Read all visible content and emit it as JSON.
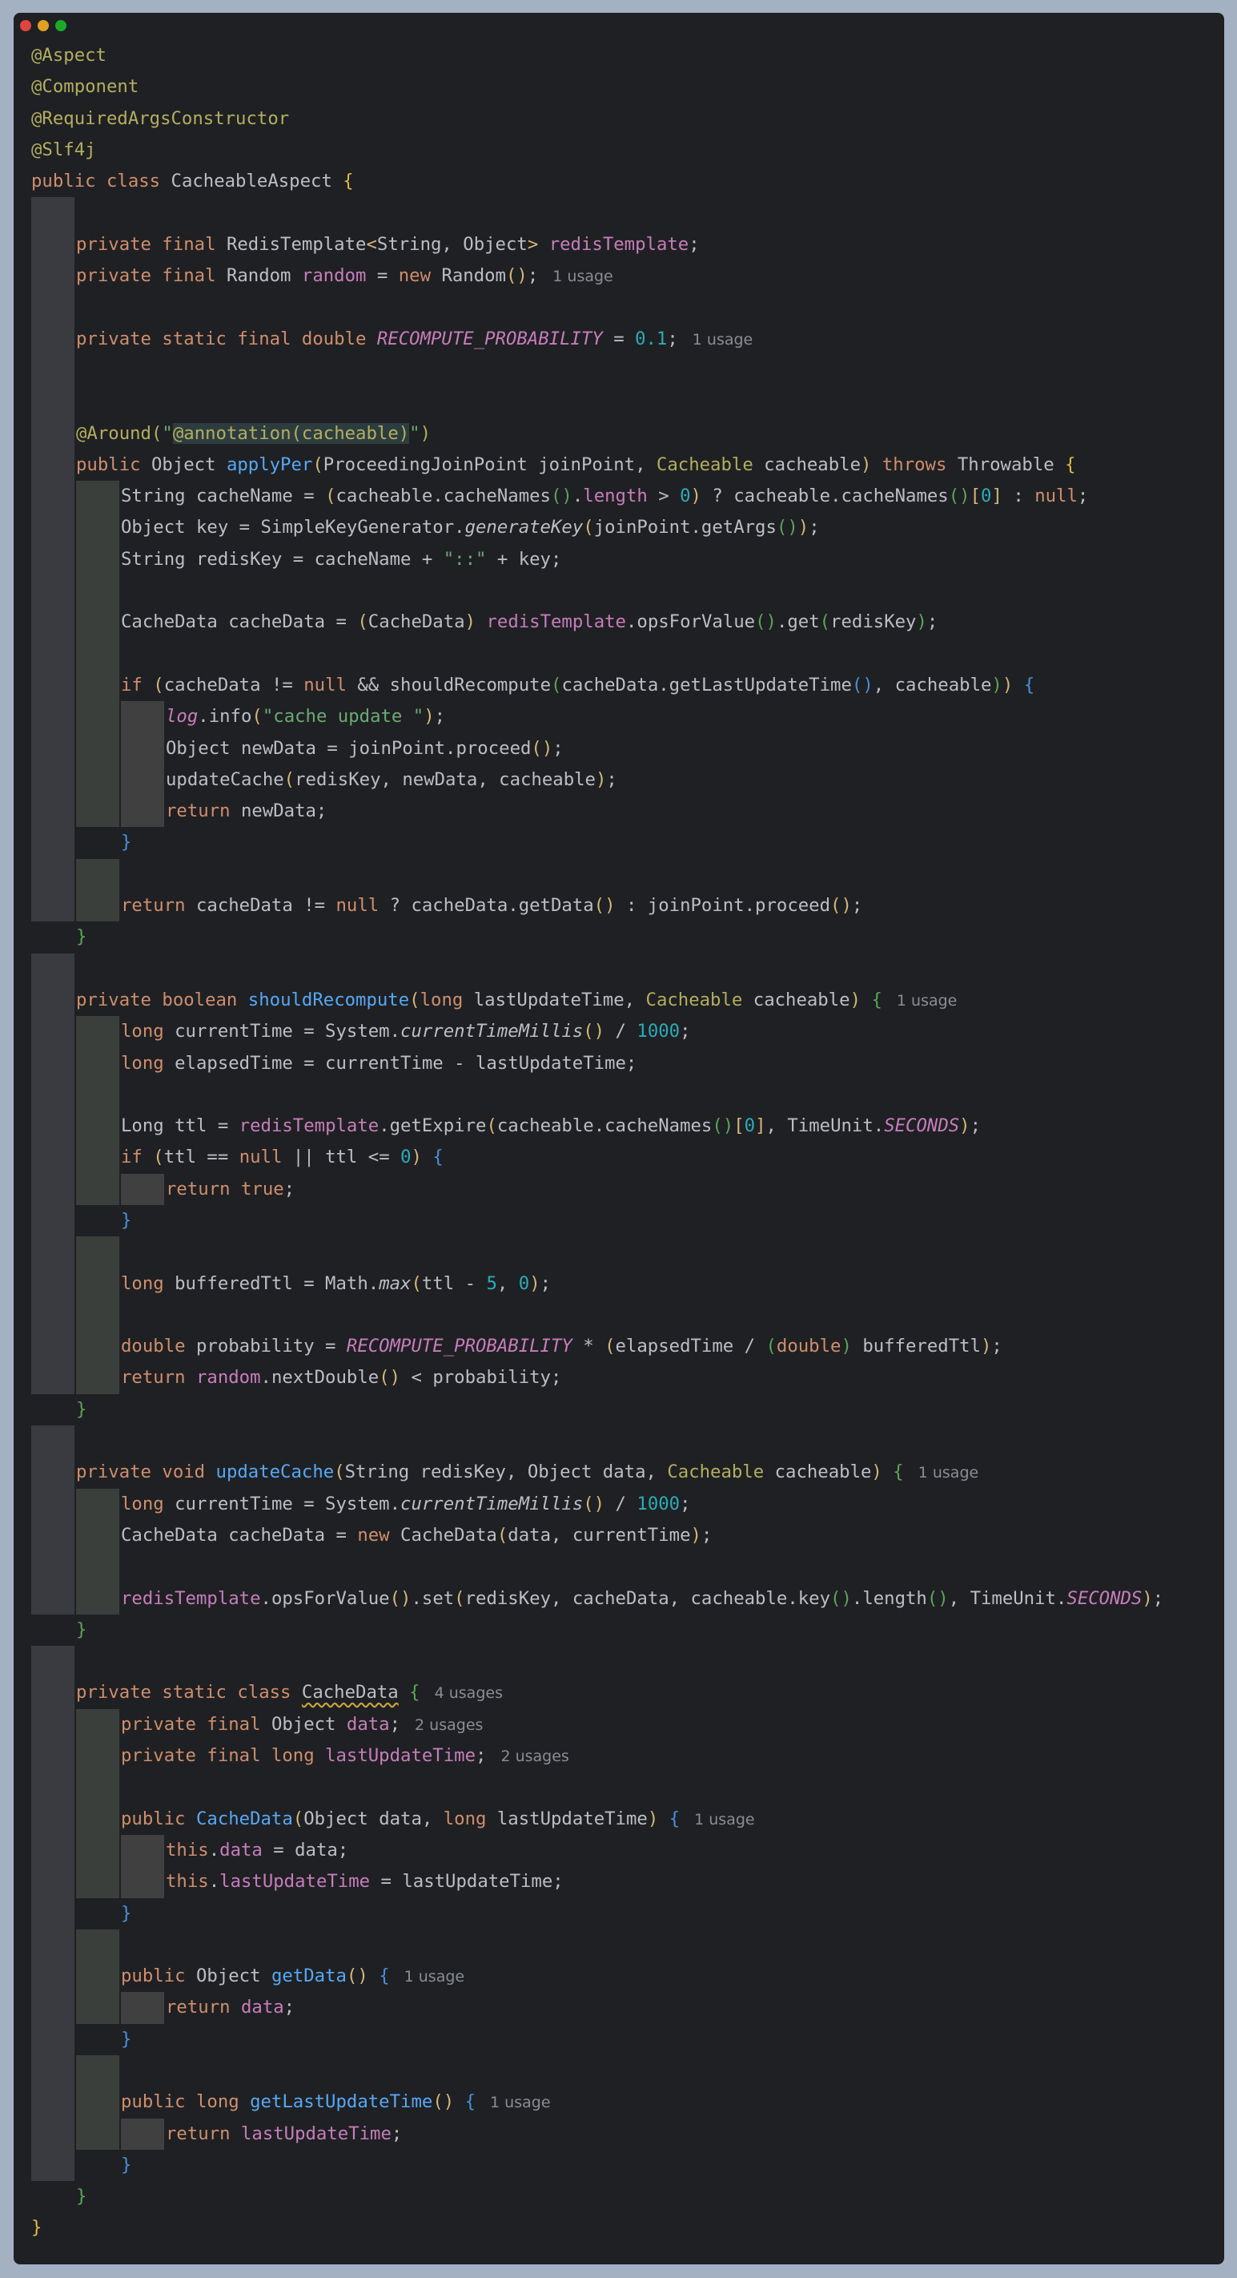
{
  "window_controls": {
    "colors": [
      "#e0443e",
      "#dea123",
      "#1aab29"
    ]
  },
  "editor": {
    "language": "java",
    "hints": {
      "one_usage": "1 usage",
      "two_usages": "2 usages",
      "four_usages": "4 usages"
    },
    "code": {
      "annotation_aspect": "@Aspect",
      "annotation_component": "@Component",
      "annotation_required_args": "@RequiredArgsConstructor",
      "annotation_slf4j": "@Slf4j",
      "class_name": "CacheableAspect",
      "field_redis_template": "redisTemplate",
      "field_random": "random",
      "constant_name": "RECOMPUTE_PROBABILITY",
      "constant_value": "0.1",
      "around_value": "@annotation(cacheable)",
      "method_apply": "applyPer",
      "method_should_recompute": "shouldRecompute",
      "method_update_cache": "updateCache",
      "inner_class": "CacheData",
      "method_get_data": "getData",
      "method_get_last_update": "getLastUpdateTime",
      "log_message": "\"cache update \"",
      "key_separator": "\"::\""
    }
  }
}
